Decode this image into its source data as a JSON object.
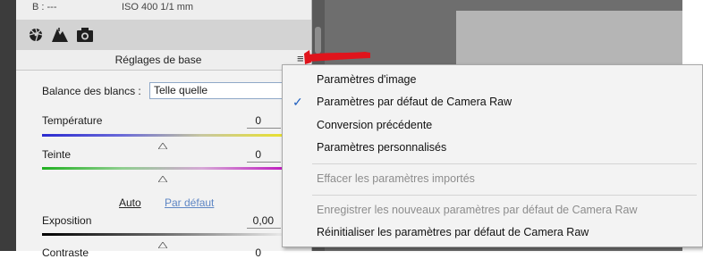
{
  "top_info": {
    "left": "B :  ---",
    "right": "ISO 400    1/1 mm"
  },
  "panel": {
    "section_title": "Réglages de base",
    "menu_glyph": "≡",
    "white_balance": {
      "label": "Balance des blancs :",
      "value": "Telle quelle"
    },
    "sliders": [
      {
        "label": "Température",
        "value": "0",
        "position": 0.5,
        "track": "blue-yellow"
      },
      {
        "label": "Teinte",
        "value": "0",
        "position": 0.5,
        "track": "green-magenta"
      },
      {
        "label": "Exposition",
        "value": "0,00",
        "position": 0.5,
        "track": "black-white"
      },
      {
        "label": "Contraste",
        "value": "0"
      }
    ],
    "auto_label": "Auto",
    "default_label": "Par défaut"
  },
  "tool_icons": [
    "aperture-icon",
    "mountain-icon",
    "camera-icon"
  ],
  "menu": {
    "items": [
      {
        "label": "Paramètres d'image",
        "checked": false,
        "disabled": false
      },
      {
        "label": "Paramètres par défaut de Camera Raw",
        "checked": true,
        "disabled": false
      },
      {
        "label": "Conversion précédente",
        "checked": false,
        "disabled": false
      },
      {
        "label": "Paramètres personnalisés",
        "checked": false,
        "disabled": false
      },
      {
        "label": "Effacer les paramètres importés",
        "checked": false,
        "disabled": true
      },
      {
        "label": "Enregistrer les nouveaux paramètres par défaut de Camera Raw",
        "checked": false,
        "disabled": true
      },
      {
        "label": "Réinitialiser les paramètres par défaut de Camera Raw",
        "checked": false,
        "disabled": false
      }
    ],
    "check_glyph": "✓"
  },
  "colors": {
    "accent": "#1f5fbf",
    "marker": "#e0141c",
    "link": "#2a5db0",
    "disabled": "#8d8d8d"
  }
}
